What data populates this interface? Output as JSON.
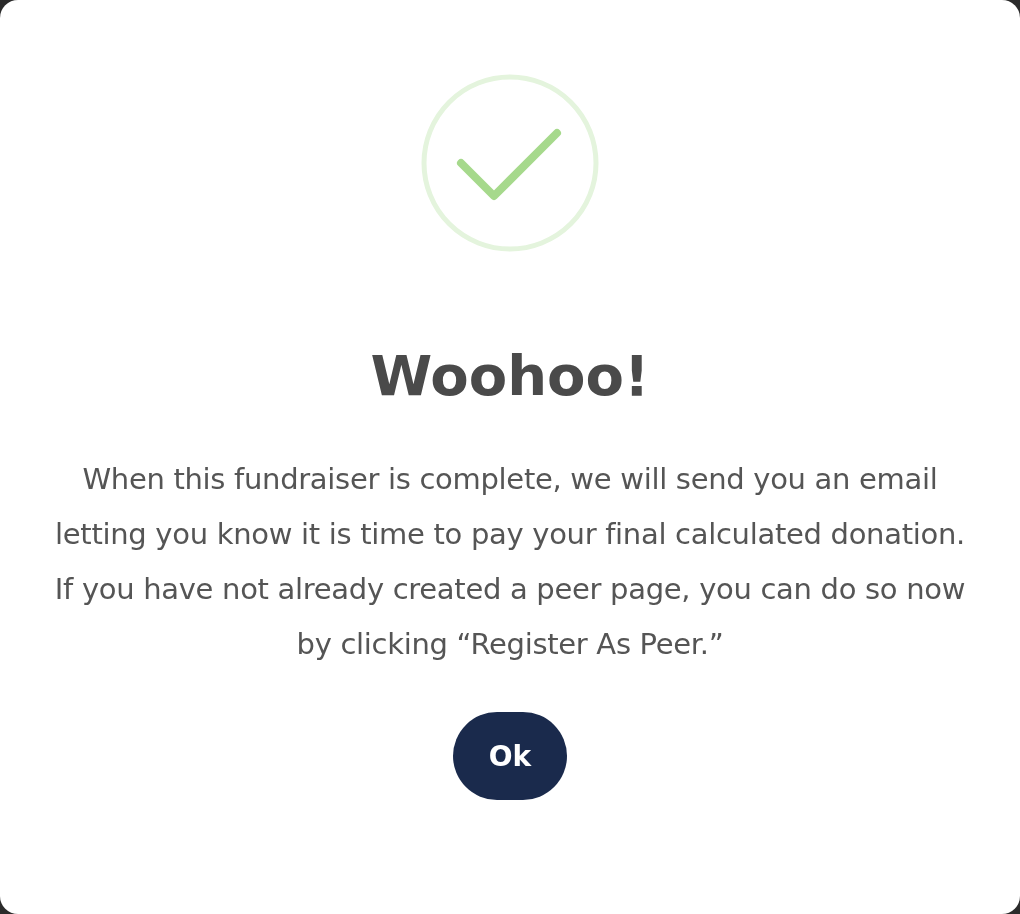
{
  "dialog": {
    "title": "Woohoo!",
    "message": "When this fundraiser is complete, we will send you an email letting you know it is time to pay your final calculated donation. If you have not already created a peer page, you can do so now by clicking “Register As Peer.”",
    "button": "Ok"
  }
}
